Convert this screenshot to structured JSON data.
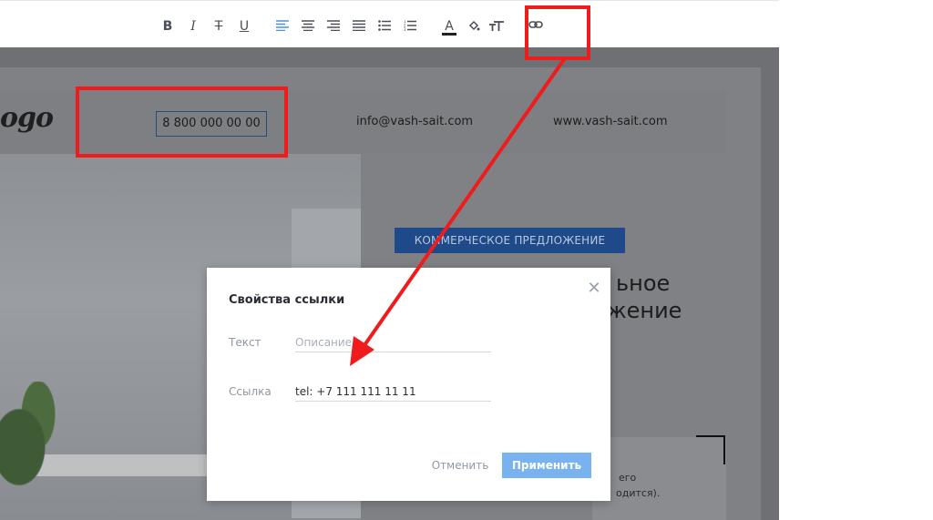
{
  "toolbar": {
    "buttons": [
      {
        "name": "bold-button",
        "label": "B"
      },
      {
        "name": "italic-button",
        "label": "I"
      },
      {
        "name": "strikethrough-button",
        "label": "T"
      },
      {
        "name": "underline-button",
        "label": "U"
      },
      {
        "name": "align-left-icon"
      },
      {
        "name": "align-center-icon"
      },
      {
        "name": "align-right-icon"
      },
      {
        "name": "align-justify-icon"
      },
      {
        "name": "bullet-list-icon"
      },
      {
        "name": "numbered-list-icon"
      },
      {
        "name": "text-color-button",
        "label": "A"
      },
      {
        "name": "fill-color-icon"
      },
      {
        "name": "font-size-icon"
      },
      {
        "name": "link-icon"
      }
    ],
    "active_accent": "#4a90e2"
  },
  "template": {
    "logo": "ogo",
    "phone": "8 800 000 00 00",
    "email": "info@vash-sait.com",
    "website": "www.vash-sait.com",
    "badge": "КОММЕРЧЕСКОЕ ПРЕДЛОЖЕНИЕ",
    "headline_line1": "ьное",
    "headline_line2": "жение",
    "fragment_1": "его",
    "fragment_2": "одится)."
  },
  "modal": {
    "title": "Свойства ссылки",
    "text_label": "Текст",
    "text_placeholder": "Описание",
    "text_value": "",
    "link_label": "Ссылка",
    "link_value": "tel: +7 111 111 11 11",
    "cancel_label": "Отменить",
    "apply_label": "Применить",
    "apply_color": "#78b3ef"
  },
  "annotations": {
    "color": "#ee1c1c"
  }
}
